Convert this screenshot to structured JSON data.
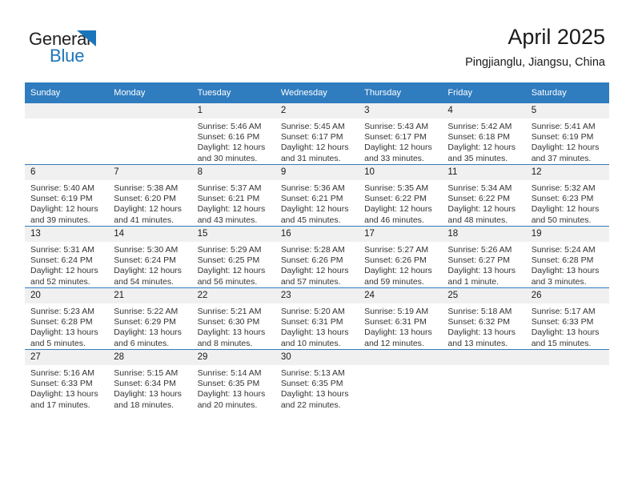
{
  "brand": {
    "name_part1": "General",
    "name_part2": "Blue",
    "triangle_color": "#1b75bb"
  },
  "header": {
    "title": "April 2025",
    "subtitle": "Pingjianglu, Jiangsu, China",
    "accent_color": "#2f7cbf",
    "daynum_band_color": "#f0f0f0"
  },
  "weekday_headers": [
    "Sunday",
    "Monday",
    "Tuesday",
    "Wednesday",
    "Thursday",
    "Friday",
    "Saturday"
  ],
  "weeks": [
    [
      {
        "day": "",
        "sunrise": "",
        "sunset": "",
        "daylight1": "",
        "daylight2": ""
      },
      {
        "day": "",
        "sunrise": "",
        "sunset": "",
        "daylight1": "",
        "daylight2": ""
      },
      {
        "day": "1",
        "sunrise": "Sunrise: 5:46 AM",
        "sunset": "Sunset: 6:16 PM",
        "daylight1": "Daylight: 12 hours",
        "daylight2": "and 30 minutes."
      },
      {
        "day": "2",
        "sunrise": "Sunrise: 5:45 AM",
        "sunset": "Sunset: 6:17 PM",
        "daylight1": "Daylight: 12 hours",
        "daylight2": "and 31 minutes."
      },
      {
        "day": "3",
        "sunrise": "Sunrise: 5:43 AM",
        "sunset": "Sunset: 6:17 PM",
        "daylight1": "Daylight: 12 hours",
        "daylight2": "and 33 minutes."
      },
      {
        "day": "4",
        "sunrise": "Sunrise: 5:42 AM",
        "sunset": "Sunset: 6:18 PM",
        "daylight1": "Daylight: 12 hours",
        "daylight2": "and 35 minutes."
      },
      {
        "day": "5",
        "sunrise": "Sunrise: 5:41 AM",
        "sunset": "Sunset: 6:19 PM",
        "daylight1": "Daylight: 12 hours",
        "daylight2": "and 37 minutes."
      }
    ],
    [
      {
        "day": "6",
        "sunrise": "Sunrise: 5:40 AM",
        "sunset": "Sunset: 6:19 PM",
        "daylight1": "Daylight: 12 hours",
        "daylight2": "and 39 minutes."
      },
      {
        "day": "7",
        "sunrise": "Sunrise: 5:38 AM",
        "sunset": "Sunset: 6:20 PM",
        "daylight1": "Daylight: 12 hours",
        "daylight2": "and 41 minutes."
      },
      {
        "day": "8",
        "sunrise": "Sunrise: 5:37 AM",
        "sunset": "Sunset: 6:21 PM",
        "daylight1": "Daylight: 12 hours",
        "daylight2": "and 43 minutes."
      },
      {
        "day": "9",
        "sunrise": "Sunrise: 5:36 AM",
        "sunset": "Sunset: 6:21 PM",
        "daylight1": "Daylight: 12 hours",
        "daylight2": "and 45 minutes."
      },
      {
        "day": "10",
        "sunrise": "Sunrise: 5:35 AM",
        "sunset": "Sunset: 6:22 PM",
        "daylight1": "Daylight: 12 hours",
        "daylight2": "and 46 minutes."
      },
      {
        "day": "11",
        "sunrise": "Sunrise: 5:34 AM",
        "sunset": "Sunset: 6:22 PM",
        "daylight1": "Daylight: 12 hours",
        "daylight2": "and 48 minutes."
      },
      {
        "day": "12",
        "sunrise": "Sunrise: 5:32 AM",
        "sunset": "Sunset: 6:23 PM",
        "daylight1": "Daylight: 12 hours",
        "daylight2": "and 50 minutes."
      }
    ],
    [
      {
        "day": "13",
        "sunrise": "Sunrise: 5:31 AM",
        "sunset": "Sunset: 6:24 PM",
        "daylight1": "Daylight: 12 hours",
        "daylight2": "and 52 minutes."
      },
      {
        "day": "14",
        "sunrise": "Sunrise: 5:30 AM",
        "sunset": "Sunset: 6:24 PM",
        "daylight1": "Daylight: 12 hours",
        "daylight2": "and 54 minutes."
      },
      {
        "day": "15",
        "sunrise": "Sunrise: 5:29 AM",
        "sunset": "Sunset: 6:25 PM",
        "daylight1": "Daylight: 12 hours",
        "daylight2": "and 56 minutes."
      },
      {
        "day": "16",
        "sunrise": "Sunrise: 5:28 AM",
        "sunset": "Sunset: 6:26 PM",
        "daylight1": "Daylight: 12 hours",
        "daylight2": "and 57 minutes."
      },
      {
        "day": "17",
        "sunrise": "Sunrise: 5:27 AM",
        "sunset": "Sunset: 6:26 PM",
        "daylight1": "Daylight: 12 hours",
        "daylight2": "and 59 minutes."
      },
      {
        "day": "18",
        "sunrise": "Sunrise: 5:26 AM",
        "sunset": "Sunset: 6:27 PM",
        "daylight1": "Daylight: 13 hours",
        "daylight2": "and 1 minute."
      },
      {
        "day": "19",
        "sunrise": "Sunrise: 5:24 AM",
        "sunset": "Sunset: 6:28 PM",
        "daylight1": "Daylight: 13 hours",
        "daylight2": "and 3 minutes."
      }
    ],
    [
      {
        "day": "20",
        "sunrise": "Sunrise: 5:23 AM",
        "sunset": "Sunset: 6:28 PM",
        "daylight1": "Daylight: 13 hours",
        "daylight2": "and 5 minutes."
      },
      {
        "day": "21",
        "sunrise": "Sunrise: 5:22 AM",
        "sunset": "Sunset: 6:29 PM",
        "daylight1": "Daylight: 13 hours",
        "daylight2": "and 6 minutes."
      },
      {
        "day": "22",
        "sunrise": "Sunrise: 5:21 AM",
        "sunset": "Sunset: 6:30 PM",
        "daylight1": "Daylight: 13 hours",
        "daylight2": "and 8 minutes."
      },
      {
        "day": "23",
        "sunrise": "Sunrise: 5:20 AM",
        "sunset": "Sunset: 6:31 PM",
        "daylight1": "Daylight: 13 hours",
        "daylight2": "and 10 minutes."
      },
      {
        "day": "24",
        "sunrise": "Sunrise: 5:19 AM",
        "sunset": "Sunset: 6:31 PM",
        "daylight1": "Daylight: 13 hours",
        "daylight2": "and 12 minutes."
      },
      {
        "day": "25",
        "sunrise": "Sunrise: 5:18 AM",
        "sunset": "Sunset: 6:32 PM",
        "daylight1": "Daylight: 13 hours",
        "daylight2": "and 13 minutes."
      },
      {
        "day": "26",
        "sunrise": "Sunrise: 5:17 AM",
        "sunset": "Sunset: 6:33 PM",
        "daylight1": "Daylight: 13 hours",
        "daylight2": "and 15 minutes."
      }
    ],
    [
      {
        "day": "27",
        "sunrise": "Sunrise: 5:16 AM",
        "sunset": "Sunset: 6:33 PM",
        "daylight1": "Daylight: 13 hours",
        "daylight2": "and 17 minutes."
      },
      {
        "day": "28",
        "sunrise": "Sunrise: 5:15 AM",
        "sunset": "Sunset: 6:34 PM",
        "daylight1": "Daylight: 13 hours",
        "daylight2": "and 18 minutes."
      },
      {
        "day": "29",
        "sunrise": "Sunrise: 5:14 AM",
        "sunset": "Sunset: 6:35 PM",
        "daylight1": "Daylight: 13 hours",
        "daylight2": "and 20 minutes."
      },
      {
        "day": "30",
        "sunrise": "Sunrise: 5:13 AM",
        "sunset": "Sunset: 6:35 PM",
        "daylight1": "Daylight: 13 hours",
        "daylight2": "and 22 minutes."
      },
      {
        "day": "",
        "sunrise": "",
        "sunset": "",
        "daylight1": "",
        "daylight2": ""
      },
      {
        "day": "",
        "sunrise": "",
        "sunset": "",
        "daylight1": "",
        "daylight2": ""
      },
      {
        "day": "",
        "sunrise": "",
        "sunset": "",
        "daylight1": "",
        "daylight2": ""
      }
    ]
  ]
}
